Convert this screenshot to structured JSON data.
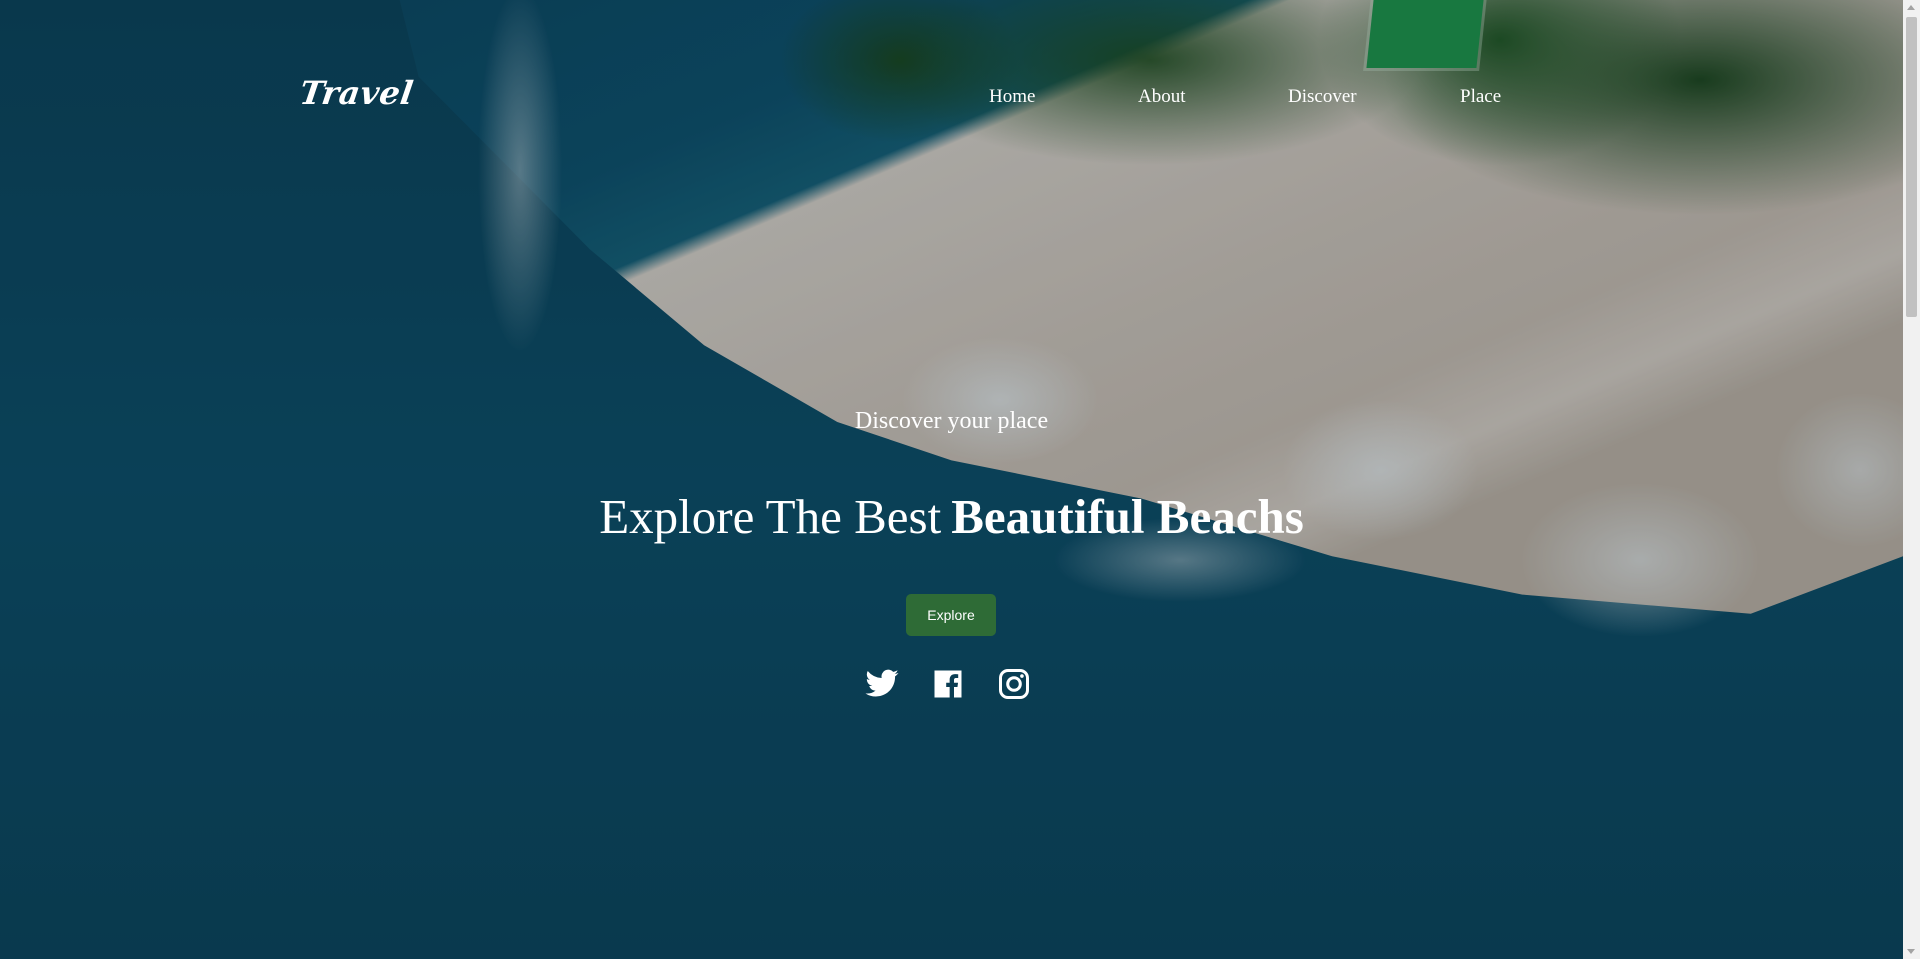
{
  "header": {
    "logo": "Travel",
    "nav": [
      {
        "label": "Home"
      },
      {
        "label": "About"
      },
      {
        "label": "Discover"
      },
      {
        "label": "Place"
      }
    ]
  },
  "hero": {
    "subtitle": "Discover your place",
    "title_regular": "Explore The Best",
    "title_bold": "Beautiful Beachs",
    "button_label": "Explore",
    "button_color": "#2e6b36"
  },
  "socials": [
    {
      "icon": "twitter-icon"
    },
    {
      "icon": "facebook-icon"
    },
    {
      "icon": "instagram-icon"
    }
  ],
  "scrollbar": {
    "position": 0
  }
}
